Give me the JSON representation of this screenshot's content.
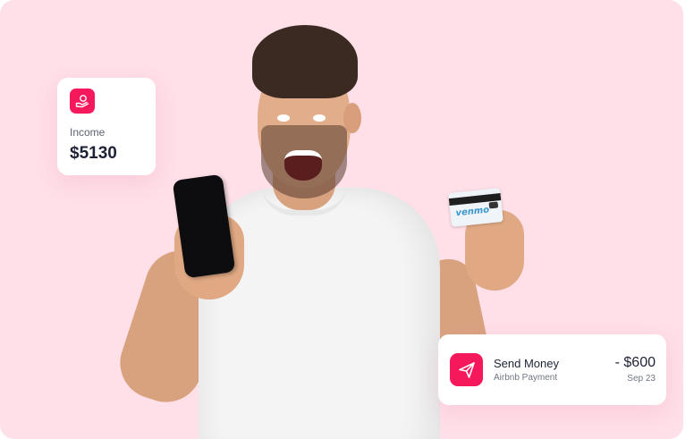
{
  "income_card": {
    "icon": "hand-coin-icon",
    "label": "Income",
    "amount": "$5130"
  },
  "transaction_card": {
    "icon": "paper-plane-icon",
    "title": "Send Money",
    "subtitle": "Airbnb Payment",
    "amount": "- $600",
    "date": "Sep 23"
  },
  "card_logo": "venmo",
  "colors": {
    "background": "#ffdfe8",
    "accent": "#f5185a",
    "text_dark": "#1d2236",
    "text_muted": "#6f7582"
  }
}
